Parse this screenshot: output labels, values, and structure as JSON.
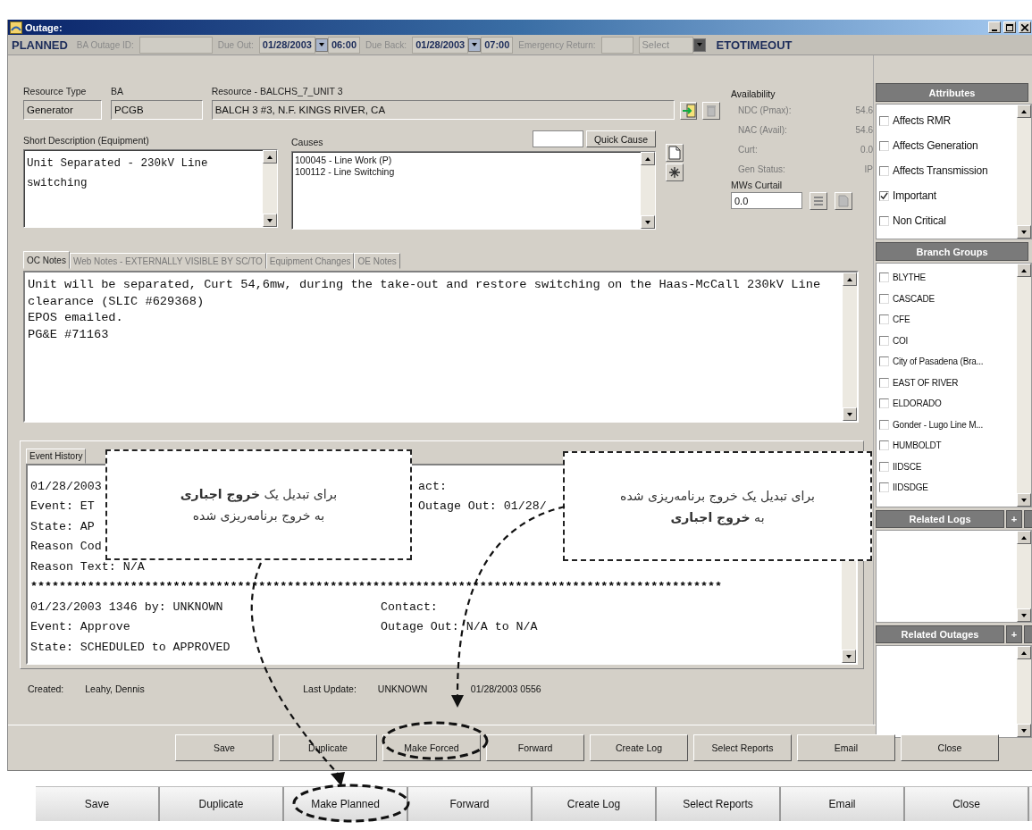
{
  "window": {
    "title": "Outage:"
  },
  "header": {
    "status": "PLANNED",
    "ba_outage_id_label": "BA Outage ID:",
    "due_out_label": "Due Out:",
    "due_out_date": "01/28/2003",
    "due_out_time": "06:00",
    "due_back_label": "Due Back:",
    "due_back_date": "01/28/2003",
    "due_back_time": "07:00",
    "emergency_return_label": "Emergency Return:",
    "select": {
      "placeholder": "Select"
    },
    "mode": "ETOTIMEOUT"
  },
  "resource_type": {
    "label": "Resource Type",
    "value": "Generator"
  },
  "ba": {
    "label": "BA",
    "value": "PCGB"
  },
  "resource": {
    "label": "Resource - BALCHS_7_UNIT 3",
    "value": "BALCH 3 #3, N.F. KINGS RIVER, CA"
  },
  "short_description": {
    "label": "Short Description (Equipment)",
    "value": "Unit Separated - 230kV Line switching"
  },
  "causes": {
    "label": "Causes",
    "items": [
      "100045 - Line Work (P)",
      "100112 - Line Switching"
    ],
    "quick_cause_button": "Quick Cause"
  },
  "availability": {
    "title": "Availability",
    "rows": [
      {
        "label": "NDC (Pmax):",
        "value": "54.6"
      },
      {
        "label": "NAC (Avail):",
        "value": "54.6"
      },
      {
        "label": "Curt:",
        "value": "0.0"
      },
      {
        "label": "Gen Status:",
        "value": "IP"
      }
    ],
    "mws_curtail": {
      "label": "MWs Curtail",
      "value": "0.0"
    }
  },
  "notes_tabs": [
    {
      "label": "OC Notes",
      "selected": true
    },
    {
      "label": "Web Notes - EXTERNALLY VISIBLE BY SC/TO",
      "selected": false
    },
    {
      "label": "Equipment Changes",
      "selected": false
    },
    {
      "label": "OE Notes",
      "selected": false
    }
  ],
  "notes_lines": [
    "Unit will be separated, Curt 54,6mw, during the take-out and restore switching on the Haas-McCall 230kV Line",
    "clearance (SLIC #629368)",
    "EPOS emailed.",
    "PG&E #71163"
  ],
  "event_history": {
    "tab": "Event History",
    "blocks": [
      {
        "covered": true,
        "lines": [
          {
            "left": "01/28/2003",
            "right": "act:"
          },
          {
            "left": "Event: ET",
            "right": "Outage Out: 01/28/"
          },
          {
            "left": "State: AP"
          },
          {
            "left": "Reason Cod"
          },
          {
            "left": "Reason Text: N/A"
          }
        ]
      },
      {
        "covered": false,
        "lines": [
          {
            "left": "01/23/2003 1346 by: UNKNOWN",
            "right": "Contact:"
          },
          {
            "left": "Event: Approve",
            "right": "Outage Out: N/A to N/A"
          },
          {
            "left": "State: SCHEDULED to APPROVED"
          }
        ]
      }
    ],
    "separator": "*************************************************************************************************"
  },
  "footer": {
    "created_label": "Created:",
    "created_by": "Leahy, Dennis",
    "last_update_label": "Last Update:",
    "last_update_by": "UNKNOWN",
    "last_update_time": "01/28/2003 0556"
  },
  "buttons": [
    "Save",
    "Duplicate",
    "Make Forced",
    "Forward",
    "Create Log",
    "Select Reports",
    "Email",
    "Close"
  ],
  "attributes": {
    "title": "Attributes",
    "items": [
      {
        "label": "Affects RMR",
        "checked": false
      },
      {
        "label": "Affects Generation",
        "checked": false
      },
      {
        "label": "Affects Transmission",
        "checked": false
      },
      {
        "label": "Important",
        "checked": true
      },
      {
        "label": "Non Critical",
        "checked": false
      }
    ]
  },
  "branch_groups": {
    "title": "Branch Groups",
    "items": [
      {
        "label": "BLYTHE",
        "checked": false
      },
      {
        "label": "CASCADE",
        "checked": false
      },
      {
        "label": "CFE",
        "checked": false
      },
      {
        "label": "COI",
        "checked": false
      },
      {
        "label": "City of Pasadena (Bra...",
        "checked": false
      },
      {
        "label": "EAST OF RIVER",
        "checked": false
      },
      {
        "label": "ELDORADO",
        "checked": false
      },
      {
        "label": "Gonder - Lugo Line M...",
        "checked": false
      },
      {
        "label": "HUMBOLDT",
        "checked": false
      },
      {
        "label": "IIDSCE",
        "checked": false
      },
      {
        "label": "IIDSDGE",
        "checked": false
      }
    ]
  },
  "related_logs": {
    "title": "Related Logs",
    "add_button": "+"
  },
  "related_outages": {
    "title": "Related Outages",
    "add_button": "+"
  },
  "callouts": [
    {
      "lines": [
        "برای تبدیل یک خروج برنامه‌ریزی شده",
        "به **خروج اجباری**"
      ]
    },
    {
      "lines": [
        "برای تبدیل یک **خروج اجباری**",
        "به خروج برنامه‌ریزی شده"
      ]
    }
  ],
  "lower_buttons": [
    "Save",
    "Duplicate",
    "Make Planned",
    "Forward",
    "Create Log",
    "Select Reports",
    "Email",
    "Close"
  ]
}
